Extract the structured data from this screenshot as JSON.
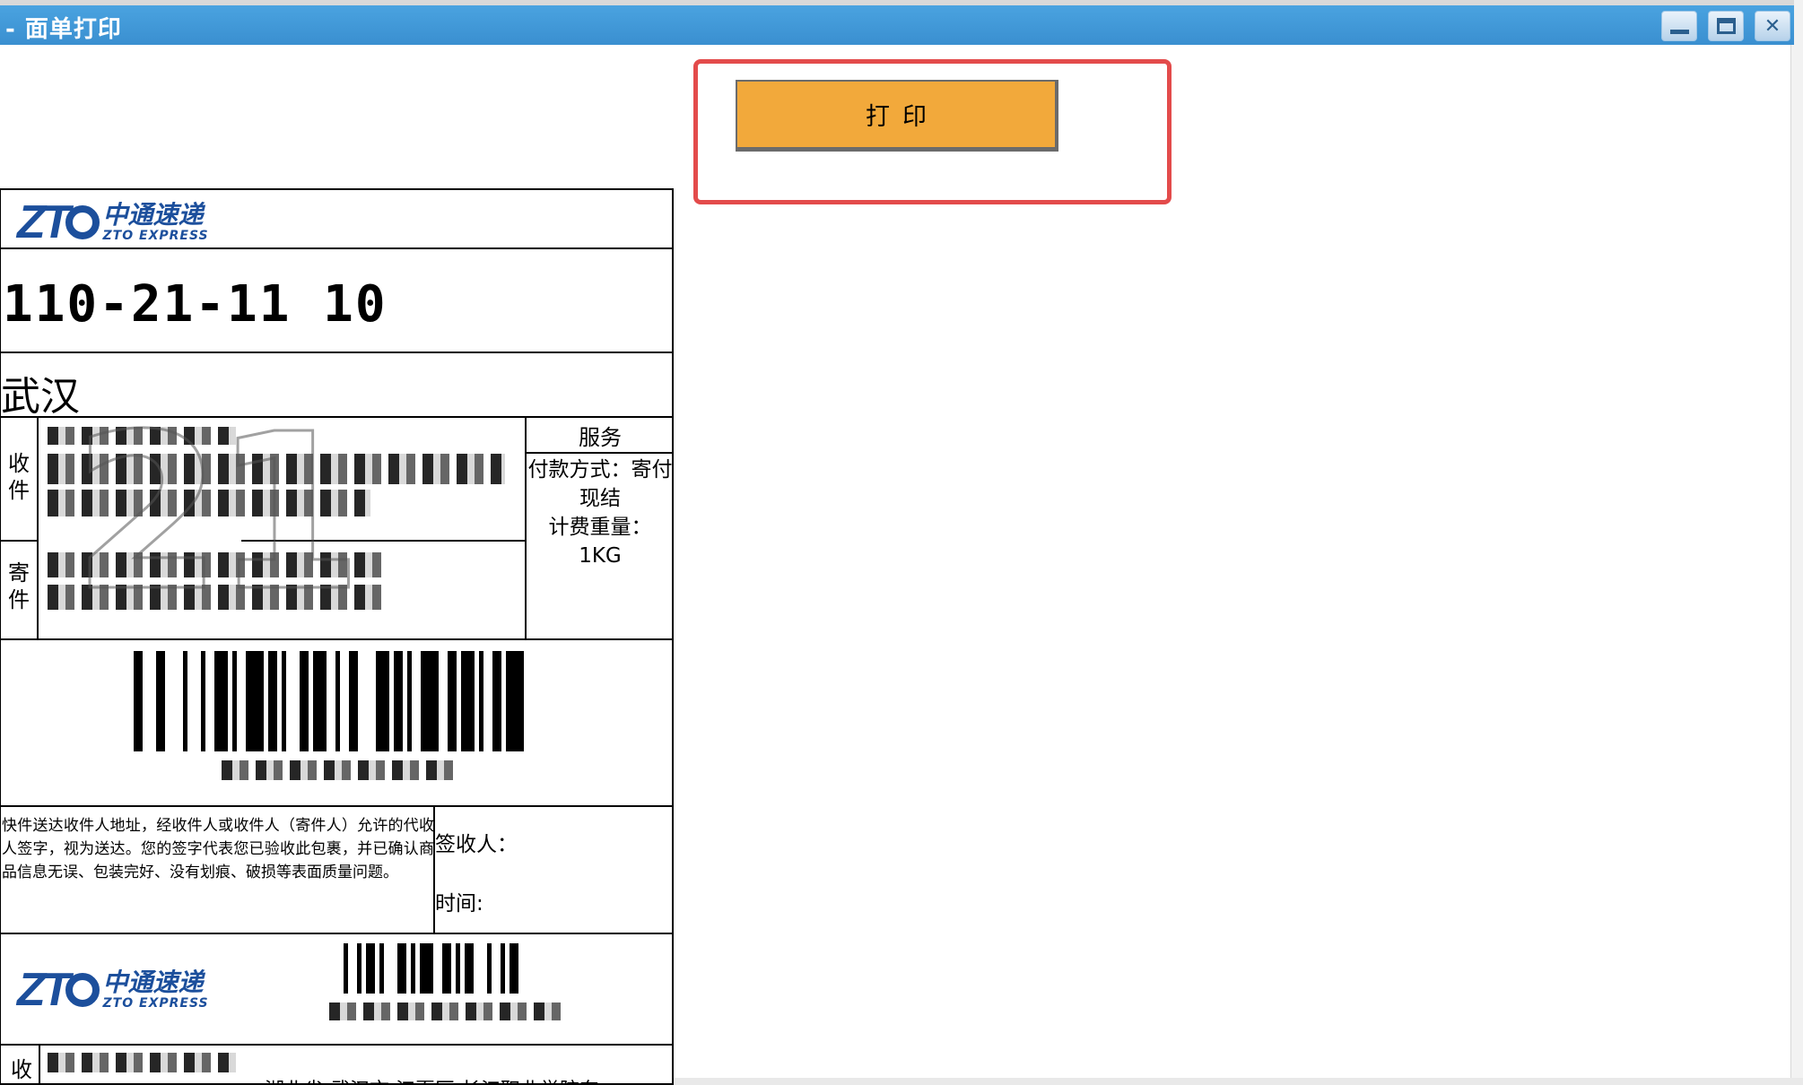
{
  "window": {
    "title": "- 面单打印",
    "minimize_label": "minimize",
    "maximize_label": "maximize",
    "close_glyph": "✕"
  },
  "toolbar": {
    "print_label": "打印"
  },
  "waybill": {
    "logo": {
      "mark_letters": "ZT",
      "name_cn": "中通速递",
      "name_en": "ZTO EXPRESS"
    },
    "route_code": "110-21-11 10",
    "destination_city": "武汉",
    "recipient_label": "收件",
    "sender_label": "寄件",
    "watermark": "21",
    "service": {
      "title": "服务",
      "payment": "付款方式：寄付现结",
      "weight_label": "计费重量：",
      "weight_value": "1KG"
    },
    "notice": "快件送达收件人地址，经收件人或收件人（寄件人）允许的代收人签字，视为送达。您的签字代表您已验收此包裹，并已确认商品信息无误、包装完好、没有划痕、破损等表面质量问题。",
    "signer_label": "签收人：",
    "time_label": "时间:",
    "bottom_recipient_label": "收",
    "bottom_address_partial": "湖北省 武汉市 江夏区 长江职业学院东"
  },
  "colors": {
    "titlebar": "#3a8fd0",
    "print_button": "#f2a93b",
    "highlight": "#e34b4b",
    "zto_blue": "#1c4f9c"
  },
  "icons": [
    "minimize-icon",
    "maximize-icon",
    "close-icon"
  ]
}
